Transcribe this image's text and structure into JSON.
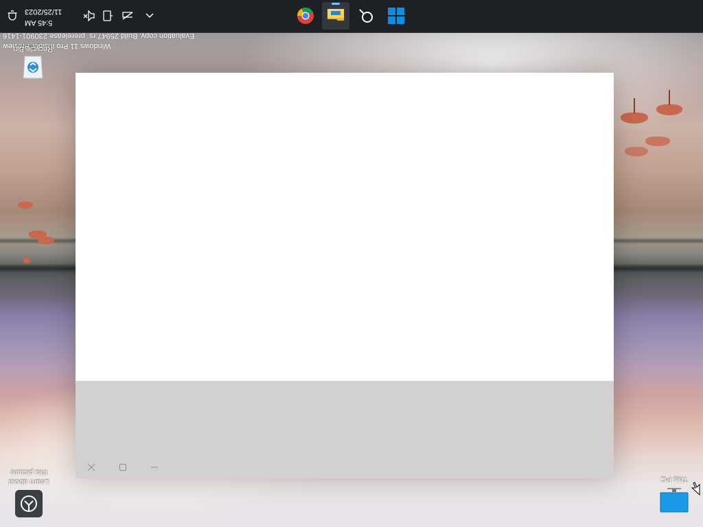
{
  "display": {
    "orientation": "rotated 180 degrees"
  },
  "taskbar": {
    "start_icon": "windows-logo-icon",
    "pinned": [
      {
        "name": "chrome",
        "icon": "chrome-icon"
      },
      {
        "name": "file-explorer",
        "icon": "folder-icon",
        "active": true
      },
      {
        "name": "search",
        "icon": "search-icon"
      }
    ],
    "tray": {
      "overflow_icon": "chevron-up-icon",
      "network_icon": "network-disconnected-icon",
      "device_icon": "device-icon",
      "volume_icon": "volume-muted-icon",
      "notification_icon": "bell-icon",
      "time": "5:45 AM",
      "date": "11/25/2023"
    }
  },
  "window": {
    "caption": {
      "minimize_icon": "minimize-icon",
      "maximize_icon": "maximize-icon",
      "close_icon": "close-icon"
    }
  },
  "desktop": {
    "icons": [
      {
        "label": "This PC",
        "icon": "this-pc-icon"
      },
      {
        "label": "Recycle Bin",
        "icon": "recycle-bin-icon"
      },
      {
        "label": "Learn about this picture",
        "icon": "learn-picture-icon"
      }
    ],
    "watermark": {
      "line1": "Windows 11 Pro Insider Preview",
      "line2": "Evaluation copy. Build 25947.rs_prerelease.230901-1416"
    }
  },
  "colors": {
    "taskbar": "#1d2125",
    "titlebar": "#d1d1d1",
    "window": "#ffffff",
    "windows_blue": "#0a8fe2"
  }
}
